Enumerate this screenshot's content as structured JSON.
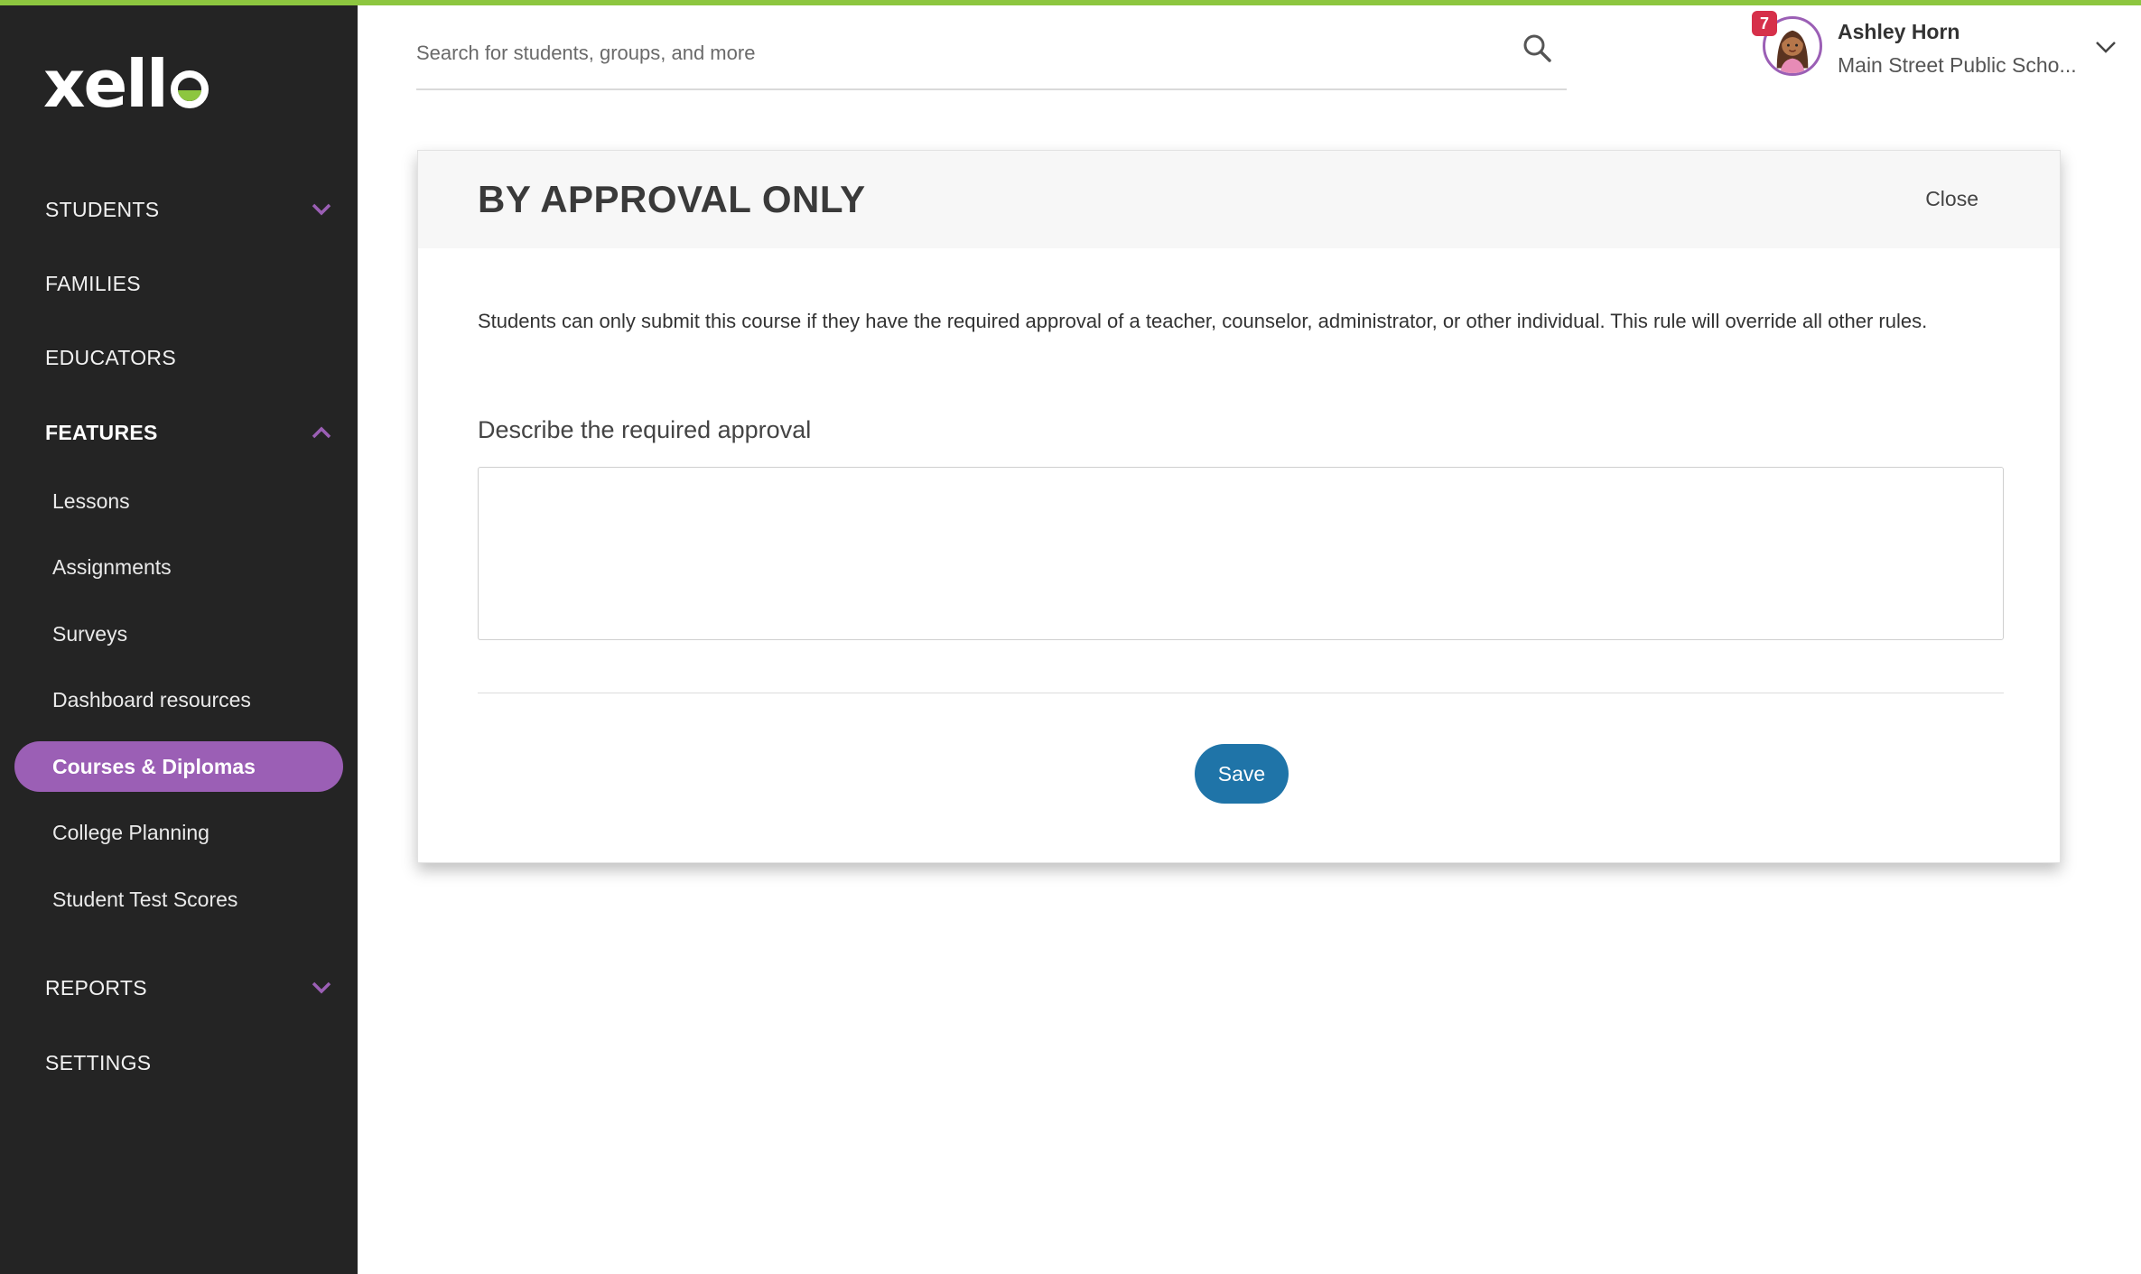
{
  "brand": {
    "name": "xello",
    "accent": "#8dc63f",
    "nav_active": "#9b5fb5",
    "primary": "#1f74a8"
  },
  "sidebar": {
    "items": [
      {
        "label": "STUDENTS",
        "expanded": false
      },
      {
        "label": "FAMILIES"
      },
      {
        "label": "EDUCATORS"
      },
      {
        "label": "FEATURES",
        "expanded": true
      },
      {
        "label": "REPORTS",
        "expanded": false
      },
      {
        "label": "SETTINGS"
      }
    ],
    "features_sub": [
      {
        "label": "Lessons"
      },
      {
        "label": "Assignments"
      },
      {
        "label": "Surveys"
      },
      {
        "label": "Dashboard resources"
      },
      {
        "label": "Courses & Diplomas",
        "active": true
      },
      {
        "label": "College Planning"
      },
      {
        "label": "Student Test Scores"
      }
    ]
  },
  "header": {
    "search_placeholder": "Search for students, groups, and more",
    "user": {
      "name": "Ashley Horn",
      "school": "Main Street Public Scho...",
      "notification_count": "7"
    }
  },
  "modal": {
    "title": "BY APPROVAL ONLY",
    "close_label": "Close",
    "description": "Students can only submit this course if they have the required approval of a teacher, counselor, administrator, or other individual. This rule will override all other rules.",
    "field_label": "Describe the required approval",
    "field_value": "",
    "save_label": "Save"
  },
  "icons": [
    "search-icon",
    "chevron-down-icon",
    "chevron-up-icon",
    "avatar"
  ]
}
